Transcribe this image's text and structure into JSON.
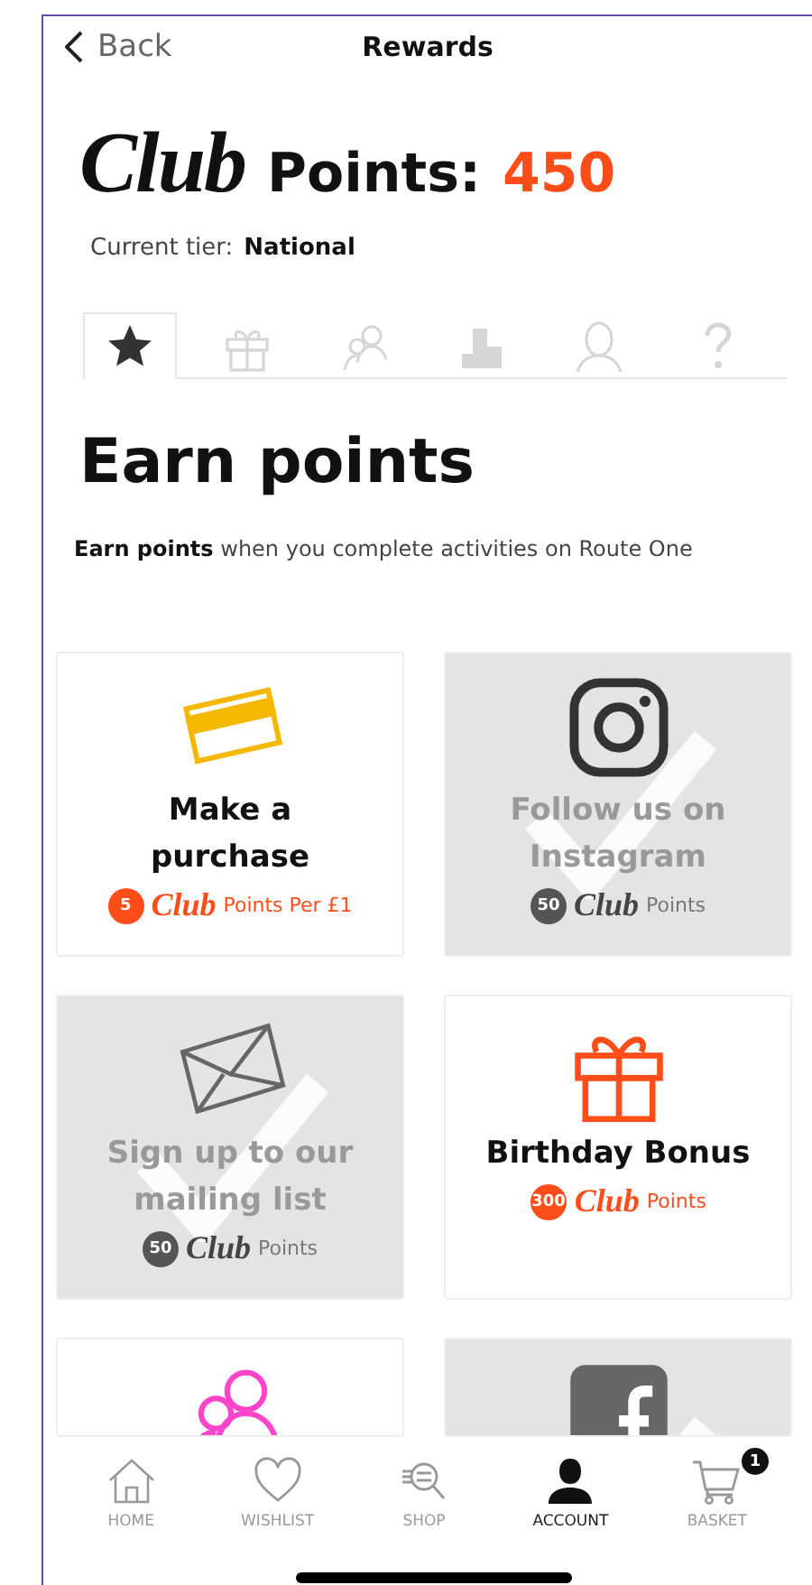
{
  "header": {
    "back": "Back",
    "title": "Rewards"
  },
  "points": {
    "club": "Club",
    "label": "Points:",
    "value": "450"
  },
  "tier": {
    "label": "Current tier:",
    "value": "National"
  },
  "tabs": [
    {
      "selected": true
    },
    {
      "selected": false
    },
    {
      "selected": false
    },
    {
      "selected": false
    },
    {
      "selected": false
    },
    {
      "selected": false
    }
  ],
  "section": {
    "title": "Earn points",
    "description": "**Earn points** when you complete activities on Route One"
  },
  "cards": [
    {
      "title": "Make a purchase",
      "badge": "5",
      "club": "Club",
      "suffix": "Points Per £1",
      "completed": false
    },
    {
      "title": "Follow us on Instagram",
      "badge": "50",
      "club": "Club",
      "suffix": "Points",
      "completed": true
    },
    {
      "title": "Sign up to our mailing list",
      "badge": "50",
      "club": "Club",
      "suffix": "Points",
      "completed": true
    },
    {
      "title": "Birthday Bonus",
      "badge": "300",
      "club": "Club",
      "suffix": "Points",
      "completed": false
    },
    {
      "completed": false
    },
    {
      "completed": true
    }
  ],
  "nav": [
    {
      "label": "HOME",
      "selected": false
    },
    {
      "label": "WISHLIST",
      "selected": false
    },
    {
      "label": "SHOP",
      "selected": false
    },
    {
      "label": "ACCOUNT",
      "selected": true
    },
    {
      "label": "BASKET",
      "selected": false,
      "badge": "1"
    }
  ]
}
